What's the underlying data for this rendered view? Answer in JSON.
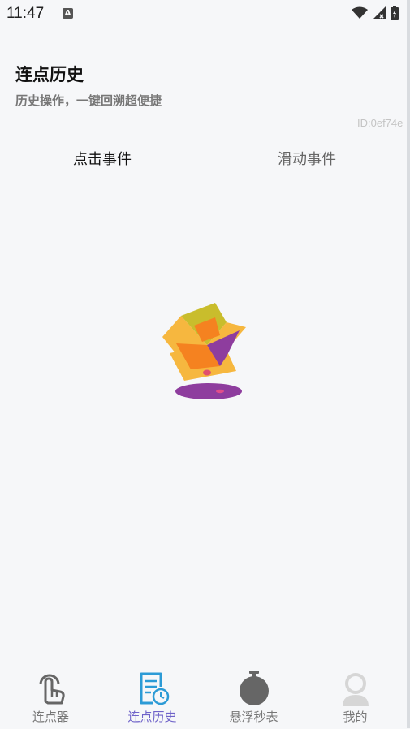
{
  "status_bar": {
    "time": "11:47",
    "notification_letter": "A",
    "icons": [
      "wifi-icon",
      "signal-icon",
      "battery-icon"
    ]
  },
  "header": {
    "title": "连点历史",
    "subtitle": "历史操作，一键回溯超便捷",
    "device_id": "ID:0ef74e"
  },
  "tabs": [
    {
      "label": "点击事件",
      "selected": true
    },
    {
      "label": "滑动事件",
      "selected": false
    }
  ],
  "empty_state": {
    "illustration": "empty-box-illustration"
  },
  "bottom_nav": {
    "active_color": "#6f63c9",
    "items": [
      {
        "label": "连点器",
        "icon": "tap-hand-icon",
        "active": false
      },
      {
        "label": "连点历史",
        "icon": "history-document-icon",
        "active": true
      },
      {
        "label": "悬浮秒表",
        "icon": "stopwatch-icon",
        "active": false
      },
      {
        "label": "我的",
        "icon": "profile-avatar-icon",
        "active": false
      }
    ]
  }
}
